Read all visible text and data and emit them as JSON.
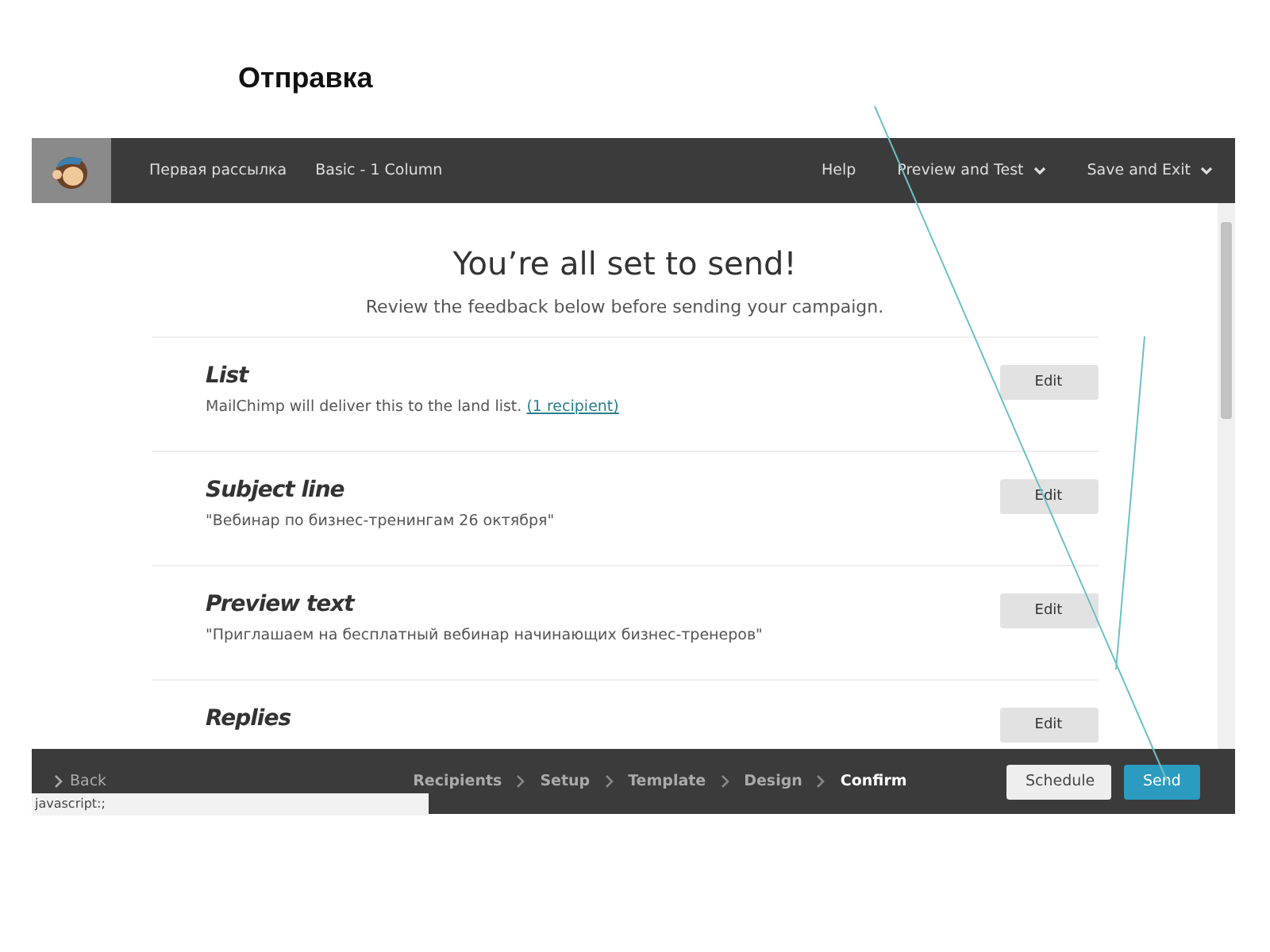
{
  "slide_title": "Отправка",
  "header": {
    "breadcrumbs": [
      "Первая рассылка",
      "Basic - 1 Column"
    ],
    "menu": [
      {
        "label": "Help",
        "dropdown": false
      },
      {
        "label": "Preview and Test",
        "dropdown": true
      },
      {
        "label": "Save and Exit",
        "dropdown": true
      }
    ]
  },
  "heading": "You’re all set to send!",
  "subheading": "Review the feedback below before sending your campaign.",
  "checklist": [
    {
      "title": "List",
      "description": "MailChimp will deliver this to the land list.",
      "link": "(1 recipient)",
      "button": "Edit"
    },
    {
      "title": "Subject line",
      "description": "\"Вебинар по бизнес-тренингам 26 октября\"",
      "button": "Edit"
    },
    {
      "title": "Preview text",
      "description": "\"Приглашаем на бесплатный вебинар начинающих бизнес-тренеров\"",
      "button": "Edit"
    },
    {
      "title": "Replies",
      "button": "Edit"
    }
  ],
  "footer": {
    "back": "Back",
    "steps": [
      {
        "label": "Recipients",
        "selected": false
      },
      {
        "label": "Setup",
        "selected": false
      },
      {
        "label": "Template",
        "selected": false
      },
      {
        "label": "Design",
        "selected": false
      },
      {
        "label": "Confirm",
        "selected": true
      }
    ],
    "buttons": [
      {
        "label": "Schedule",
        "kind": "secondary"
      },
      {
        "label": "Send",
        "kind": "primary"
      }
    ]
  },
  "status_url": "javascript:;"
}
